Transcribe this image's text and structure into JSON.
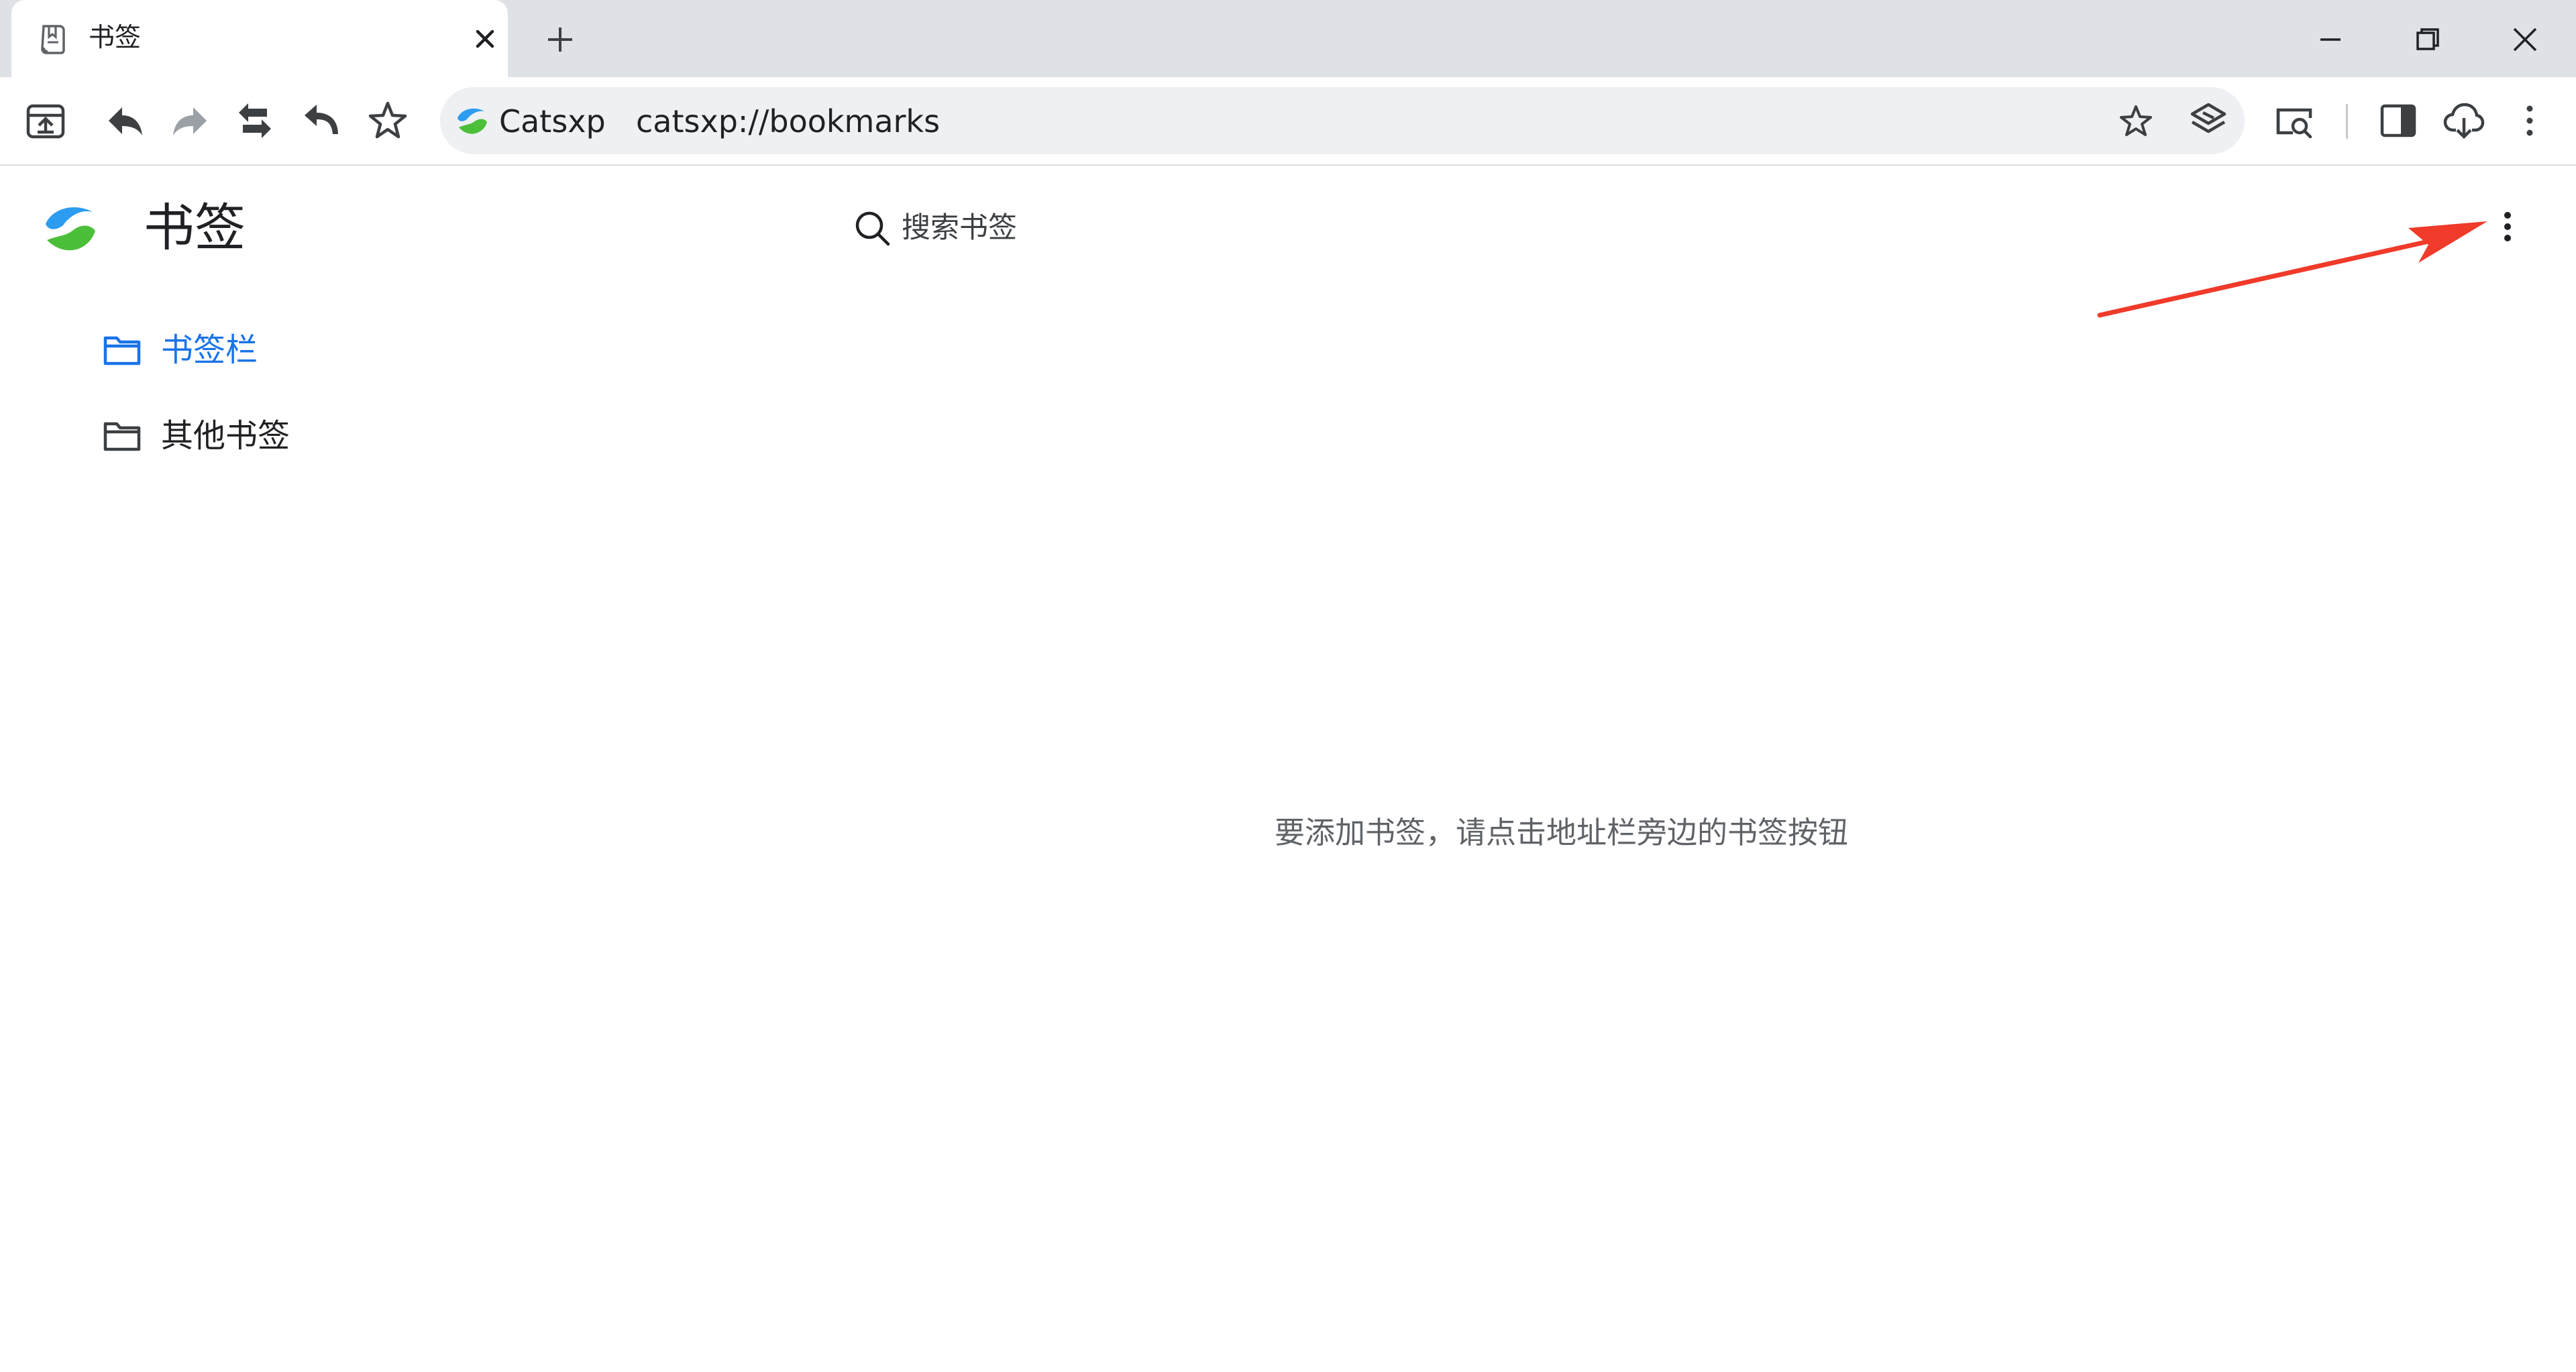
{
  "tab": {
    "title": "书签",
    "icon": "bookmarks-page-icon"
  },
  "new_tab_icon": "plus-icon",
  "window_controls": [
    "minimize-icon",
    "restore-icon",
    "close-icon"
  ],
  "toolbar": {
    "buttons_left": [
      "upload-icon",
      "back-icon",
      "forward-icon",
      "sync-icon",
      "undo-icon",
      "star-outline-icon"
    ],
    "omnibox": {
      "brand": "Catsxp",
      "url": "catsxp://bookmarks"
    },
    "buttons_right": [
      "reading-search-icon",
      "side-panel-icon",
      "cloud-download-icon",
      "more-vert-icon"
    ]
  },
  "page": {
    "title": "书签",
    "search_placeholder": "搜索书签",
    "folders": [
      {
        "label": "书签栏",
        "selected": true
      },
      {
        "label": "其他书签",
        "selected": false
      }
    ],
    "empty_message": "要添加书签，请点击地址栏旁边的书签按钮"
  },
  "colors": {
    "tabstrip_bg": "#dee1e6",
    "accent_blue": "#1a73e8",
    "annotation_red": "#f03a2a",
    "logo_blue": "#2c9cf0",
    "logo_green": "#4cbf3a"
  }
}
